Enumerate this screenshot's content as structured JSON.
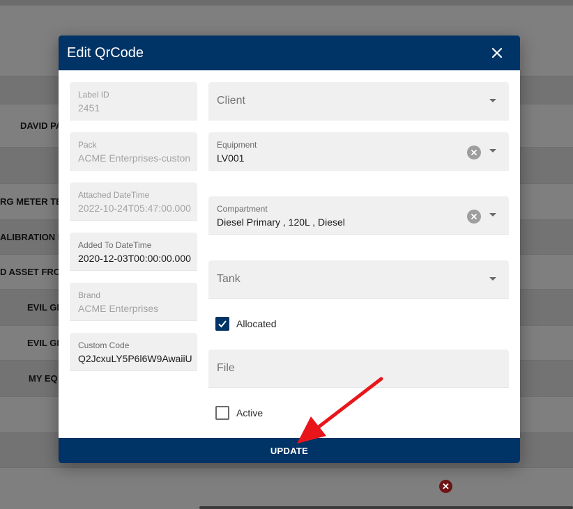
{
  "background": {
    "rows": [
      {
        "text": "DAVID PA"
      },
      {
        "text": "RG METER TE"
      },
      {
        "text": "ALIBRATION M"
      },
      {
        "text": "D ASSET FRO"
      },
      {
        "text": "EVIL GE"
      },
      {
        "text": "EVIL GE"
      },
      {
        "text": "MY EQ"
      }
    ],
    "delete_icon": "close-circle-icon"
  },
  "dialog": {
    "title": "Edit QrCode",
    "close_icon": "close-icon",
    "left_fields": [
      {
        "label": "Label ID",
        "value": "2451"
      },
      {
        "label": "Pack",
        "value": "ACME Enterprises-custon"
      },
      {
        "label": "Attached DateTime",
        "value": "2022-10-24T05:47:00.000"
      },
      {
        "label": "Added To DateTime",
        "value": "2020-12-03T00:00:00.000"
      },
      {
        "label": "Brand",
        "value": "ACME Enterprises"
      },
      {
        "label": "Custom Code",
        "value": "Q2JcxuLY5P6l6W9AwaiiU"
      }
    ],
    "client": {
      "placeholder": "Client"
    },
    "equipment": {
      "label": "Equipment",
      "value": "LV001"
    },
    "compartment": {
      "label": "Compartment",
      "value": "Diesel Primary , 120L , Diesel"
    },
    "tank": {
      "placeholder": "Tank"
    },
    "allocated": {
      "label": "Allocated",
      "checked": true
    },
    "file": {
      "placeholder": "File"
    },
    "active": {
      "label": "Active",
      "checked": false
    },
    "update_label": "UPDATE"
  },
  "colors": {
    "primary": "#003366",
    "annotation": "#e8161b"
  }
}
